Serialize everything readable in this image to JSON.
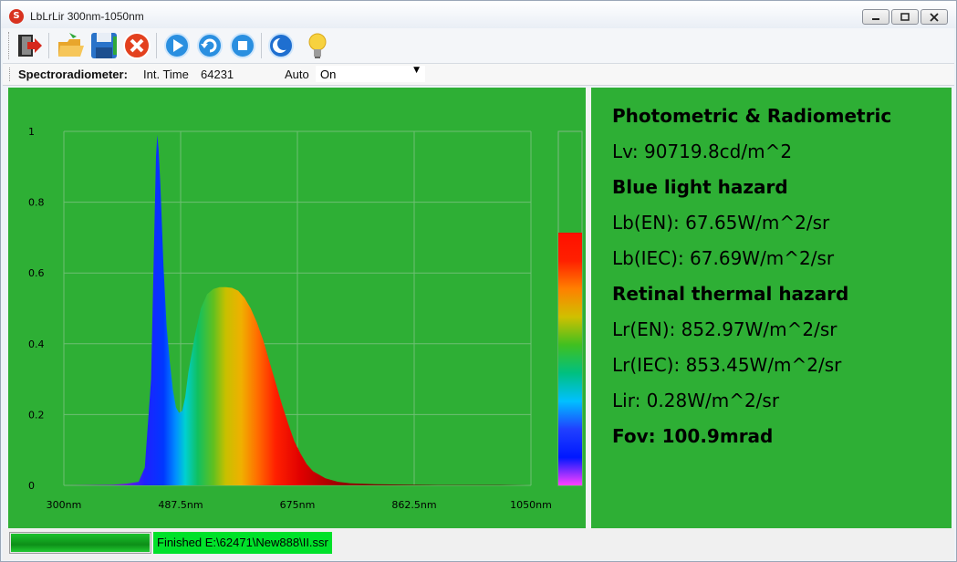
{
  "window": {
    "title": "LbLrLir 300nm-1050nm",
    "app_icon_glyph": "S"
  },
  "toolbar": {
    "buttons": [
      {
        "name": "exit-icon"
      },
      {
        "name": "open-folder-icon"
      },
      {
        "name": "save-disk-icon"
      },
      {
        "name": "cancel-x-icon"
      },
      {
        "name": "play-icon"
      },
      {
        "name": "refresh-icon"
      },
      {
        "name": "stop-icon"
      },
      {
        "name": "moon-icon"
      },
      {
        "name": "lightbulb-icon"
      }
    ]
  },
  "settings": {
    "device_label": "Spectroradiometer:",
    "int_time_label": "Int. Time",
    "int_time_value": "64231",
    "mode_label": "Auto",
    "mode_value": "On"
  },
  "info": {
    "section_photometric": "Photometric & Radiometric",
    "lv": "Lv: 90719.8cd/m^2",
    "section_blue": "Blue light hazard",
    "lb_en": "Lb(EN): 67.65W/m^2/sr",
    "lb_iec": "Lb(IEC): 67.69W/m^2/sr",
    "section_retinal": "Retinal thermal hazard",
    "lr_en": "Lr(EN): 852.97W/m^2/sr",
    "lr_iec": "Lr(IEC): 853.45W/m^2/sr",
    "lir": "Lir: 0.28W/m^2/sr",
    "fov": "Fov: 100.9mrad"
  },
  "status": {
    "progress": 1.0,
    "message": "Finished E:\\62471\\New888\\II.ssr"
  },
  "colors": {
    "panel_green": "#2eaf35",
    "status_green": "#00e12a"
  },
  "chart_data": {
    "type": "area",
    "xlim": [
      300,
      1050
    ],
    "ylim": [
      0,
      1
    ],
    "x_ticks": [
      "300nm",
      "487.5nm",
      "675nm",
      "862.5nm",
      "1050nm"
    ],
    "y_ticks": [
      "0",
      "0.2",
      "0.4",
      "0.6",
      "0.8",
      "1"
    ],
    "grid": true,
    "fill": "spectral-gradient",
    "x": [
      300,
      380,
      400,
      420,
      430,
      440,
      445,
      448,
      450,
      452,
      455,
      460,
      465,
      470,
      475,
      480,
      485,
      490,
      495,
      500,
      510,
      520,
      530,
      540,
      550,
      560,
      570,
      580,
      590,
      600,
      610,
      620,
      630,
      640,
      650,
      660,
      670,
      680,
      690,
      700,
      720,
      740,
      760,
      800,
      850,
      900,
      950,
      1000,
      1050
    ],
    "y": [
      0,
      0.002,
      0.005,
      0.01,
      0.05,
      0.3,
      0.7,
      0.93,
      0.99,
      0.95,
      0.85,
      0.62,
      0.45,
      0.35,
      0.27,
      0.22,
      0.205,
      0.21,
      0.25,
      0.32,
      0.42,
      0.5,
      0.54,
      0.555,
      0.56,
      0.56,
      0.558,
      0.55,
      0.53,
      0.5,
      0.46,
      0.41,
      0.35,
      0.29,
      0.23,
      0.175,
      0.125,
      0.09,
      0.06,
      0.04,
      0.02,
      0.01,
      0.006,
      0.003,
      0.002,
      0.001,
      0.001,
      0.001,
      0
    ]
  }
}
